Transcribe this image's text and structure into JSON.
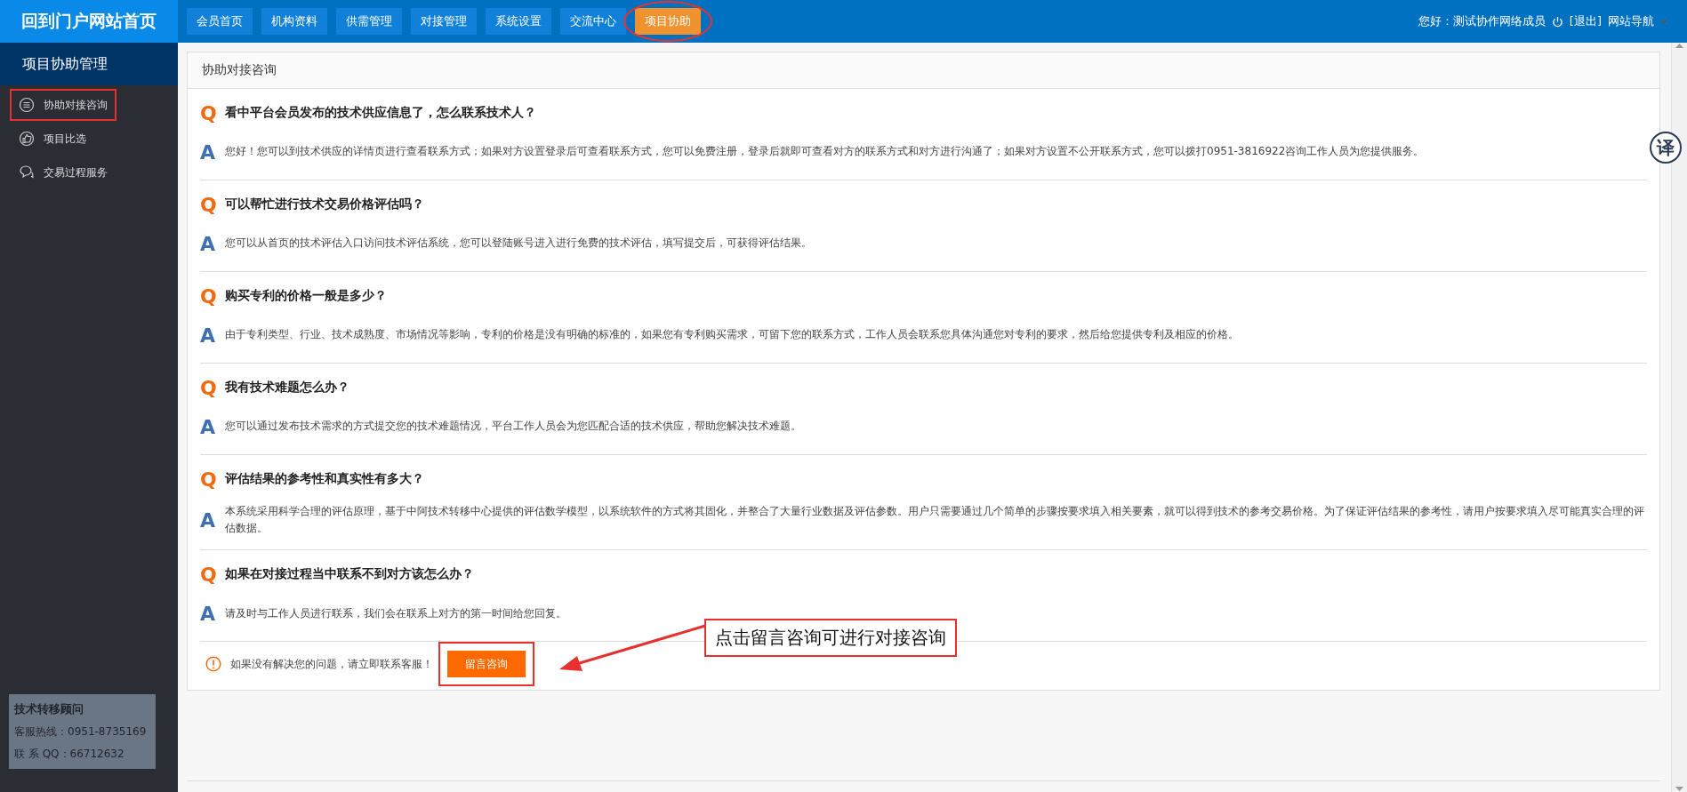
{
  "brand": "回到门户网站首页",
  "nav": [
    {
      "label": "会员首页",
      "selected": false
    },
    {
      "label": "机构资料",
      "selected": false
    },
    {
      "label": "供需管理",
      "selected": false
    },
    {
      "label": "对接管理",
      "selected": false
    },
    {
      "label": "系统设置",
      "selected": false
    },
    {
      "label": "交流中心",
      "selected": false
    },
    {
      "label": "项目协助",
      "selected": true
    }
  ],
  "user": {
    "greeting": "您好：测试协作网络成员",
    "logout": "[退出]",
    "site_nav": "网站导航"
  },
  "sidebar": {
    "title": "项目协助管理",
    "items": [
      {
        "label": "协助对接咨询",
        "selected": true
      },
      {
        "label": "项目比选",
        "selected": false
      },
      {
        "label": "交易过程服务",
        "selected": false
      }
    ]
  },
  "advisor": {
    "title": "技术转移顾问",
    "hotline": "客服热线：0951-8735169",
    "qq": "联 系 QQ：66712632"
  },
  "panel": {
    "title": "协助对接咨询",
    "faqs": [
      {
        "q_mark": "Q",
        "a_mark": "A",
        "question": "看中平台会员发布的技术供应信息了，怎么联系技术人？",
        "answer": "您好！您可以到技术供应的详情页进行查看联系方式；如果对方设置登录后可查看联系方式，您可以免费注册，登录后就即可查看对方的联系方式和对方进行沟通了；如果对方设置不公开联系方式，您可以拨打0951-3816922咨询工作人员为您提供服务。"
      },
      {
        "q_mark": "Q",
        "a_mark": "A",
        "question": "可以帮忙进行技术交易价格评估吗？",
        "answer": "您可以从首页的技术评估入口访问技术评估系统，您可以登陆账号进入进行免费的技术评估，填写提交后，可获得评估结果。"
      },
      {
        "q_mark": "Q",
        "a_mark": "A",
        "question": "购买专利的价格一般是多少？",
        "answer": "由于专利类型、行业、技术成熟度、市场情况等影响，专利的价格是没有明确的标准的，如果您有专利购买需求，可留下您的联系方式，工作人员会联系您具体沟通您对专利的要求，然后给您提供专利及相应的价格。"
      },
      {
        "q_mark": "Q",
        "a_mark": "A",
        "question": "我有技术难题怎么办？",
        "answer": "您可以通过发布技术需求的方式提交您的技术难题情况，平台工作人员会为您匹配合适的技术供应，帮助您解决技术难题。"
      },
      {
        "q_mark": "Q",
        "a_mark": "A",
        "question": "评估结果的参考性和真实性有多大？",
        "answer": "本系统采用科学合理的评估原理，基于中阿技术转移中心提供的评估数学模型，以系统软件的方式将其固化，并整合了大量行业数据及评估参数。用户只需要通过几个简单的步骤按要求填入相关要素，就可以得到技术的参考交易价格。为了保证评估结果的参考性，请用户按要求填入尽可能真实合理的评估数据。"
      },
      {
        "q_mark": "Q",
        "a_mark": "A",
        "question": "如果在对接过程当中联系不到对方该怎么办？",
        "answer": "请及时与工作人员进行联系，我们会在联系上对方的第一时间给您回复。"
      }
    ],
    "notice": "如果没有解决您的问题，请立即联系客服！",
    "button": "留言咨询"
  },
  "callout": "点击留言咨询可进行对接咨询",
  "translate_badge": "译"
}
